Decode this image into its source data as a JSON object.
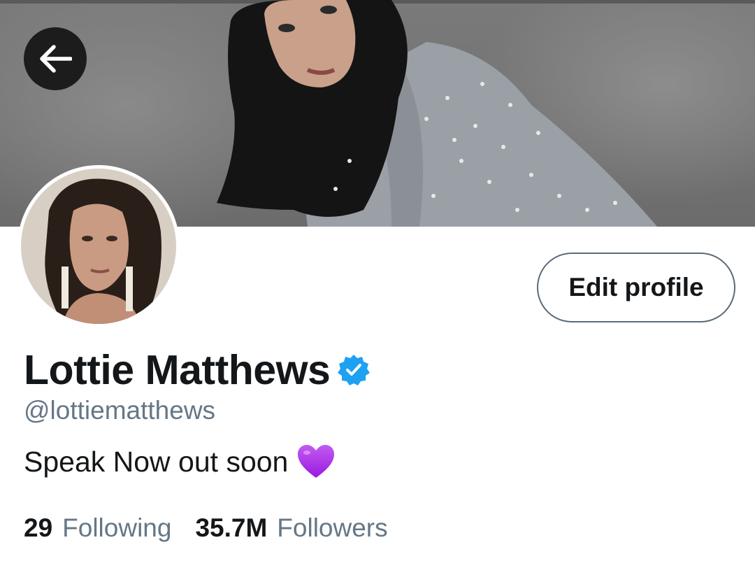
{
  "profile": {
    "display_name": "Lottie Matthews",
    "handle": "@lottiematthews",
    "bio": "Speak Now out soon",
    "bio_emoji": "purple-heart-icon",
    "verified": true,
    "verified_color": "#1DA1F2"
  },
  "actions": {
    "back_icon": "arrow-left-icon",
    "edit_profile_label": "Edit profile"
  },
  "stats": {
    "following_count": "29",
    "following_label": "Following",
    "followers_count": "35.7M",
    "followers_label": "Followers"
  },
  "colors": {
    "text_primary": "#14171A",
    "text_secondary": "#657786",
    "heart": "#A020F0"
  }
}
